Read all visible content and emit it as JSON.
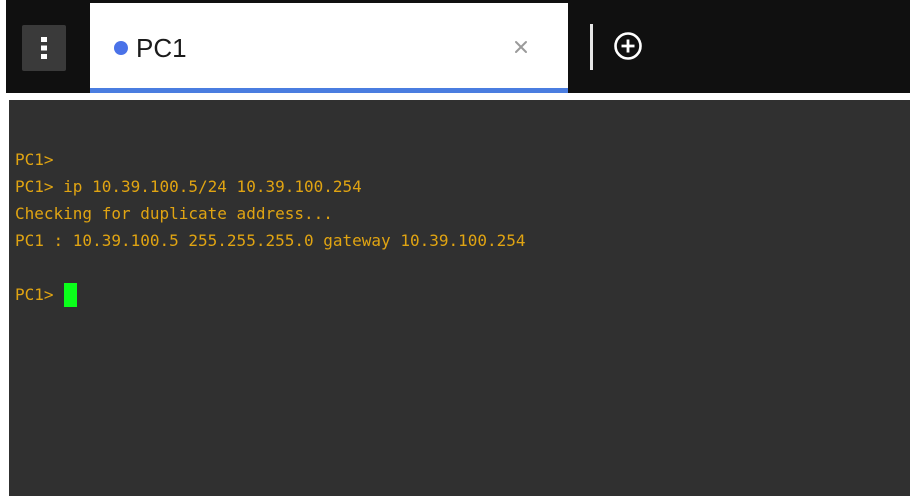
{
  "tab": {
    "title": "PC1",
    "status_color": "#4a72e8"
  },
  "icons": {
    "menu": "kebab-menu-icon",
    "close": "close-icon",
    "new_tab": "plus-circle-icon"
  },
  "terminal": {
    "lines": [
      "PC1>",
      "PC1> ip 10.39.100.5/24 10.39.100.254",
      "Checking for duplicate address...",
      "PC1 : 10.39.100.5 255.255.255.0 gateway 10.39.100.254",
      ""
    ],
    "prompt": "PC1>",
    "text_color": "#e0a412",
    "cursor_color": "#0aff1a",
    "background": "#303030"
  }
}
